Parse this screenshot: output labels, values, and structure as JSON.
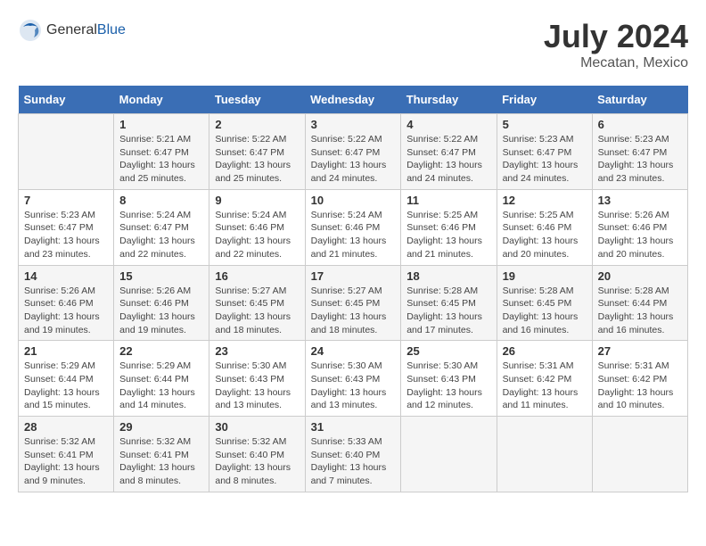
{
  "header": {
    "logo_general": "General",
    "logo_blue": "Blue",
    "month_year": "July 2024",
    "location": "Mecatan, Mexico"
  },
  "days_of_week": [
    "Sunday",
    "Monday",
    "Tuesday",
    "Wednesday",
    "Thursday",
    "Friday",
    "Saturday"
  ],
  "weeks": [
    [
      {
        "num": "",
        "info": ""
      },
      {
        "num": "1",
        "info": "Sunrise: 5:21 AM\nSunset: 6:47 PM\nDaylight: 13 hours\nand 25 minutes."
      },
      {
        "num": "2",
        "info": "Sunrise: 5:22 AM\nSunset: 6:47 PM\nDaylight: 13 hours\nand 25 minutes."
      },
      {
        "num": "3",
        "info": "Sunrise: 5:22 AM\nSunset: 6:47 PM\nDaylight: 13 hours\nand 24 minutes."
      },
      {
        "num": "4",
        "info": "Sunrise: 5:22 AM\nSunset: 6:47 PM\nDaylight: 13 hours\nand 24 minutes."
      },
      {
        "num": "5",
        "info": "Sunrise: 5:23 AM\nSunset: 6:47 PM\nDaylight: 13 hours\nand 24 minutes."
      },
      {
        "num": "6",
        "info": "Sunrise: 5:23 AM\nSunset: 6:47 PM\nDaylight: 13 hours\nand 23 minutes."
      }
    ],
    [
      {
        "num": "7",
        "info": "Sunrise: 5:23 AM\nSunset: 6:47 PM\nDaylight: 13 hours\nand 23 minutes."
      },
      {
        "num": "8",
        "info": "Sunrise: 5:24 AM\nSunset: 6:47 PM\nDaylight: 13 hours\nand 22 minutes."
      },
      {
        "num": "9",
        "info": "Sunrise: 5:24 AM\nSunset: 6:46 PM\nDaylight: 13 hours\nand 22 minutes."
      },
      {
        "num": "10",
        "info": "Sunrise: 5:24 AM\nSunset: 6:46 PM\nDaylight: 13 hours\nand 21 minutes."
      },
      {
        "num": "11",
        "info": "Sunrise: 5:25 AM\nSunset: 6:46 PM\nDaylight: 13 hours\nand 21 minutes."
      },
      {
        "num": "12",
        "info": "Sunrise: 5:25 AM\nSunset: 6:46 PM\nDaylight: 13 hours\nand 20 minutes."
      },
      {
        "num": "13",
        "info": "Sunrise: 5:26 AM\nSunset: 6:46 PM\nDaylight: 13 hours\nand 20 minutes."
      }
    ],
    [
      {
        "num": "14",
        "info": "Sunrise: 5:26 AM\nSunset: 6:46 PM\nDaylight: 13 hours\nand 19 minutes."
      },
      {
        "num": "15",
        "info": "Sunrise: 5:26 AM\nSunset: 6:46 PM\nDaylight: 13 hours\nand 19 minutes."
      },
      {
        "num": "16",
        "info": "Sunrise: 5:27 AM\nSunset: 6:45 PM\nDaylight: 13 hours\nand 18 minutes."
      },
      {
        "num": "17",
        "info": "Sunrise: 5:27 AM\nSunset: 6:45 PM\nDaylight: 13 hours\nand 18 minutes."
      },
      {
        "num": "18",
        "info": "Sunrise: 5:28 AM\nSunset: 6:45 PM\nDaylight: 13 hours\nand 17 minutes."
      },
      {
        "num": "19",
        "info": "Sunrise: 5:28 AM\nSunset: 6:45 PM\nDaylight: 13 hours\nand 16 minutes."
      },
      {
        "num": "20",
        "info": "Sunrise: 5:28 AM\nSunset: 6:44 PM\nDaylight: 13 hours\nand 16 minutes."
      }
    ],
    [
      {
        "num": "21",
        "info": "Sunrise: 5:29 AM\nSunset: 6:44 PM\nDaylight: 13 hours\nand 15 minutes."
      },
      {
        "num": "22",
        "info": "Sunrise: 5:29 AM\nSunset: 6:44 PM\nDaylight: 13 hours\nand 14 minutes."
      },
      {
        "num": "23",
        "info": "Sunrise: 5:30 AM\nSunset: 6:43 PM\nDaylight: 13 hours\nand 13 minutes."
      },
      {
        "num": "24",
        "info": "Sunrise: 5:30 AM\nSunset: 6:43 PM\nDaylight: 13 hours\nand 13 minutes."
      },
      {
        "num": "25",
        "info": "Sunrise: 5:30 AM\nSunset: 6:43 PM\nDaylight: 13 hours\nand 12 minutes."
      },
      {
        "num": "26",
        "info": "Sunrise: 5:31 AM\nSunset: 6:42 PM\nDaylight: 13 hours\nand 11 minutes."
      },
      {
        "num": "27",
        "info": "Sunrise: 5:31 AM\nSunset: 6:42 PM\nDaylight: 13 hours\nand 10 minutes."
      }
    ],
    [
      {
        "num": "28",
        "info": "Sunrise: 5:32 AM\nSunset: 6:41 PM\nDaylight: 13 hours\nand 9 minutes."
      },
      {
        "num": "29",
        "info": "Sunrise: 5:32 AM\nSunset: 6:41 PM\nDaylight: 13 hours\nand 8 minutes."
      },
      {
        "num": "30",
        "info": "Sunrise: 5:32 AM\nSunset: 6:40 PM\nDaylight: 13 hours\nand 8 minutes."
      },
      {
        "num": "31",
        "info": "Sunrise: 5:33 AM\nSunset: 6:40 PM\nDaylight: 13 hours\nand 7 minutes."
      },
      {
        "num": "",
        "info": ""
      },
      {
        "num": "",
        "info": ""
      },
      {
        "num": "",
        "info": ""
      }
    ]
  ]
}
